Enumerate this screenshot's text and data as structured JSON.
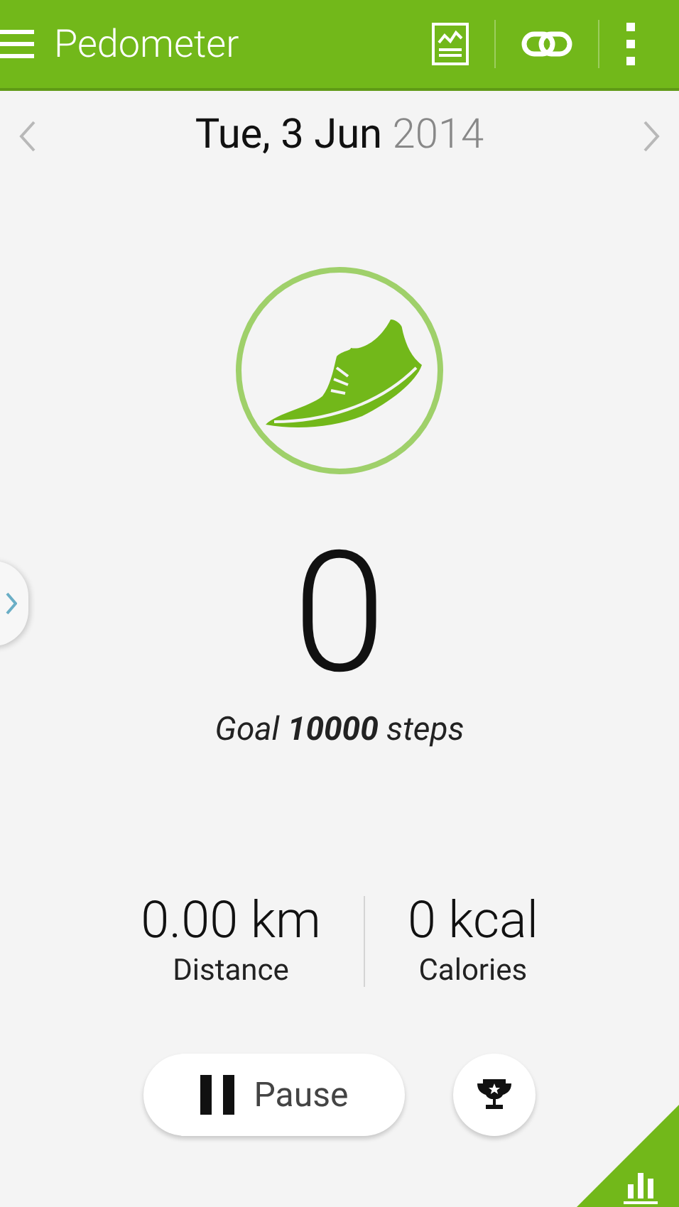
{
  "app_bar": {
    "title": "Pedometer"
  },
  "date": {
    "day": "Tue, 3 Jun",
    "year": "2014"
  },
  "steps": {
    "count": "0",
    "goal": "Goal **10000** steps"
  },
  "stats": [
    {
      "value": "0.00 km",
      "label": "Distance"
    },
    {
      "value": "0 kcal",
      "label": "Calories"
    }
  ],
  "pause_button": {
    "label": "Pause"
  }
}
